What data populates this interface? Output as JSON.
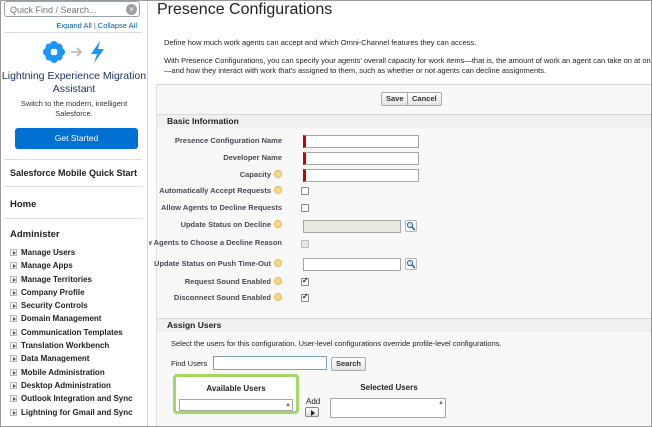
{
  "sidebar": {
    "quick_find_placeholder": "Quick Find / Search...",
    "expand_all": "Expand All",
    "separator": "|",
    "collapse_all": "Collapse All",
    "promo": {
      "title": "Lightning Experience Migration Assistant",
      "subtitle": "Switch to the modern, intelligent Salesforce.",
      "button": "Get Started",
      "accent_color": "#0070d2"
    },
    "mobile_quick_start": "Salesforce Mobile Quick Start",
    "home": "Home",
    "administer": "Administer",
    "admin_items": [
      "Manage Users",
      "Manage Apps",
      "Manage Territories",
      "Company Profile",
      "Security Controls",
      "Domain Management",
      "Communication Templates",
      "Translation Workbench",
      "Data Management",
      "Mobile Administration",
      "Desktop Administration",
      "Outlook Integration and Sync",
      "Lightning for Gmail and Sync"
    ]
  },
  "main": {
    "title": "Presence Configurations",
    "intro1": "Define how much work agents can accept and which Omni-Channel features they can access.",
    "intro2": "With Presence Configurations, you can specify your agents' overall capacity for work items—that is, the amount of work an agent can take on at once—and how they interact with work that's assigned to them, such as whether or not agents can decline assignments.",
    "save": "Save",
    "cancel": "Cancel",
    "basic_info": "Basic Information",
    "fields": {
      "presence_config_name": "Presence Configuration Name",
      "developer_name": "Developer Name",
      "capacity": "Capacity",
      "auto_accept": "Automatically Accept Requests",
      "allow_decline": "Allow Agents to Decline Requests",
      "status_on_decline": "Update Status on Decline",
      "choose_decline_reason": "Allow Agents to Choose a Decline Reason",
      "status_on_timeout": "Update Status on Push Time-Out",
      "request_sound": "Request Sound Enabled",
      "disconnect_sound": "Disconnect Sound Enabled"
    },
    "assign_users": {
      "title": "Assign Users",
      "description": "Select the users for this configuration. User-level configurations override profile-level configurations.",
      "find_users_label": "Find Users",
      "search": "Search",
      "available_users": "Available Users",
      "add": "Add",
      "selected_users": "Selected Users"
    },
    "colors": {
      "required_marker": "#cc0000",
      "highlight_border": "#a5d667"
    }
  }
}
